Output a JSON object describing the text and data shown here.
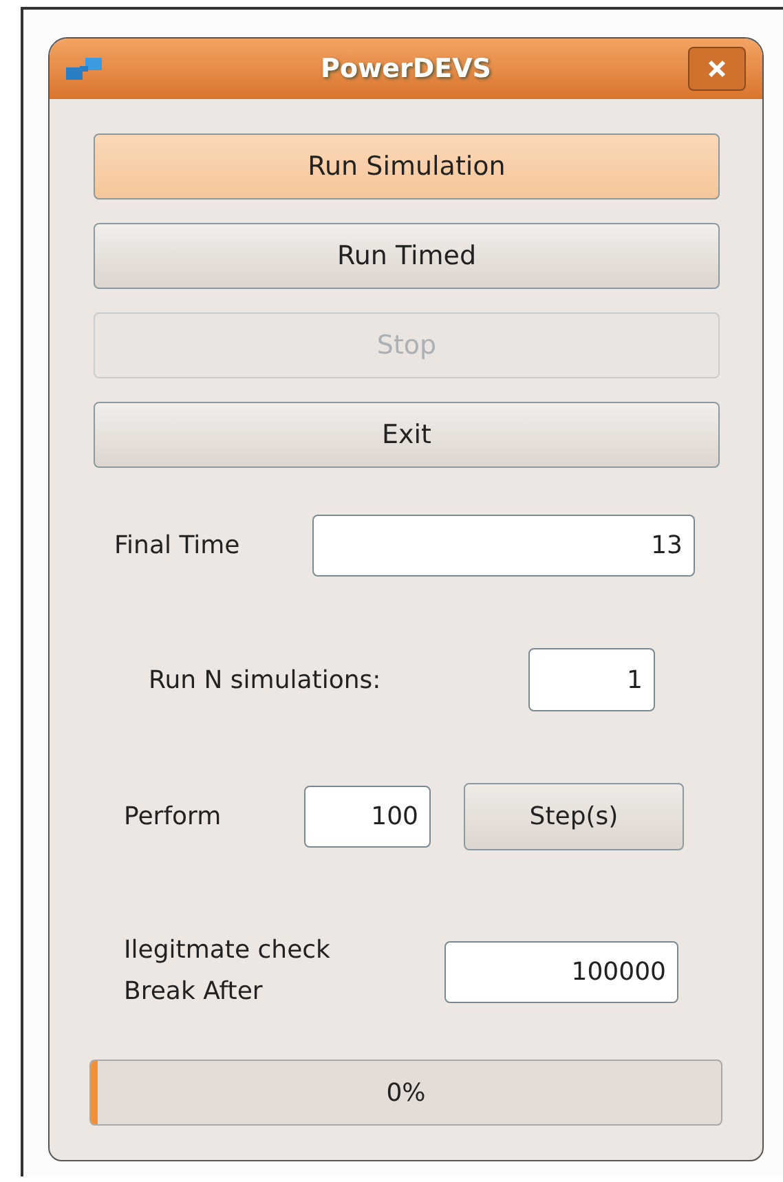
{
  "window": {
    "title": "PowerDEVS"
  },
  "buttons": [
    {
      "label": "Run Simulation",
      "selected": true,
      "disabled": false
    },
    {
      "label": "Run Timed",
      "selected": false,
      "disabled": false
    },
    {
      "label": "Stop",
      "selected": false,
      "disabled": true
    },
    {
      "label": "Exit",
      "selected": false,
      "disabled": false
    }
  ],
  "final_time": {
    "label": "Final Time",
    "value": "13"
  },
  "run_n": {
    "label": "Run N simulations:",
    "value": "1"
  },
  "perform": {
    "label": "Perform",
    "value": "100",
    "button": "Step(s)"
  },
  "illegitimate": {
    "label_lines": [
      "Ilegitmate check",
      "Break After"
    ],
    "value": "100000"
  },
  "progress": {
    "level": 0.01,
    "text": "0%"
  }
}
